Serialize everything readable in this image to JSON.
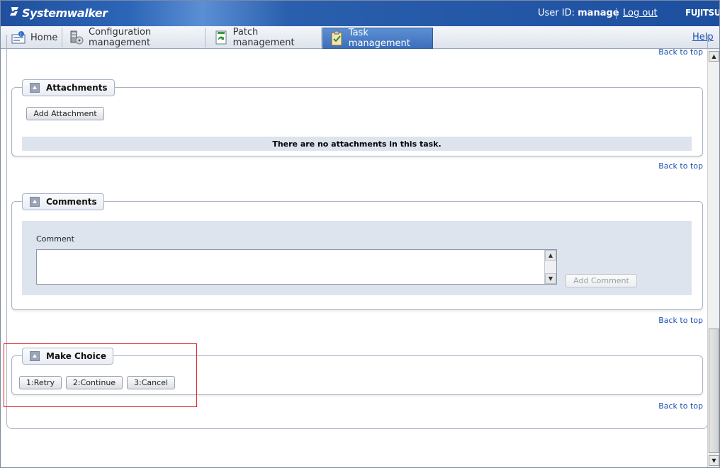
{
  "header": {
    "app_title": "Systemwalker",
    "user_label": "User ID:",
    "user_name": "manage",
    "logout": "Log out",
    "brand": "FUJITSU"
  },
  "tabs": [
    {
      "label": "Home",
      "icon": "home-icon"
    },
    {
      "label": "Configuration management",
      "icon": "server-icon"
    },
    {
      "label": "Patch management",
      "icon": "patch-icon"
    },
    {
      "label": "Task management",
      "icon": "clipboard-icon",
      "active": true
    }
  ],
  "help": "Help",
  "back_to_top": "Back to top",
  "attachments": {
    "title": "Attachments",
    "add_button": "Add Attachment",
    "empty_message": "There are no attachments in this task."
  },
  "comments": {
    "title": "Comments",
    "label": "Comment",
    "value": "",
    "add_button": "Add Comment"
  },
  "make_choice": {
    "title": "Make Choice",
    "options": [
      "1:Retry",
      "2:Continue",
      "3:Cancel"
    ]
  },
  "colors": {
    "header_blue": "#1f4f9e",
    "active_tab": "#3c6fbc",
    "panel_bg": "#dde4ee",
    "highlight_red": "#e02020",
    "link": "#1a4fb3"
  }
}
